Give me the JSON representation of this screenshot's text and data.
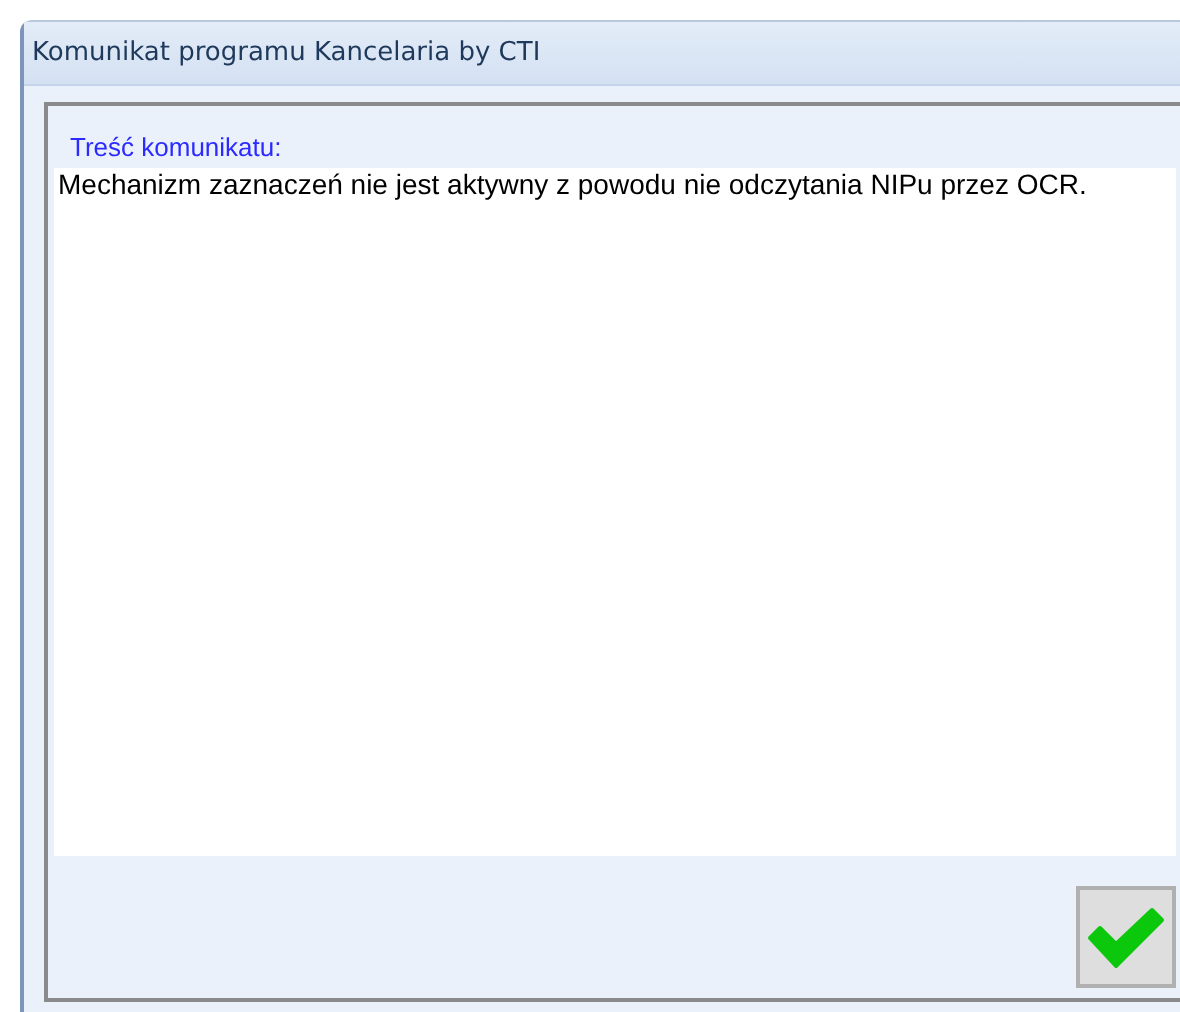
{
  "window": {
    "title": "Komunikat programu Kancelaria by CTI"
  },
  "message": {
    "label": "Treść komunikatu:",
    "text": "Mechanizm zaznaczeń nie jest aktywny z powodu nie odczytania NIPu przez OCR."
  },
  "buttons": [
    {
      "kind": "ok"
    }
  ]
}
